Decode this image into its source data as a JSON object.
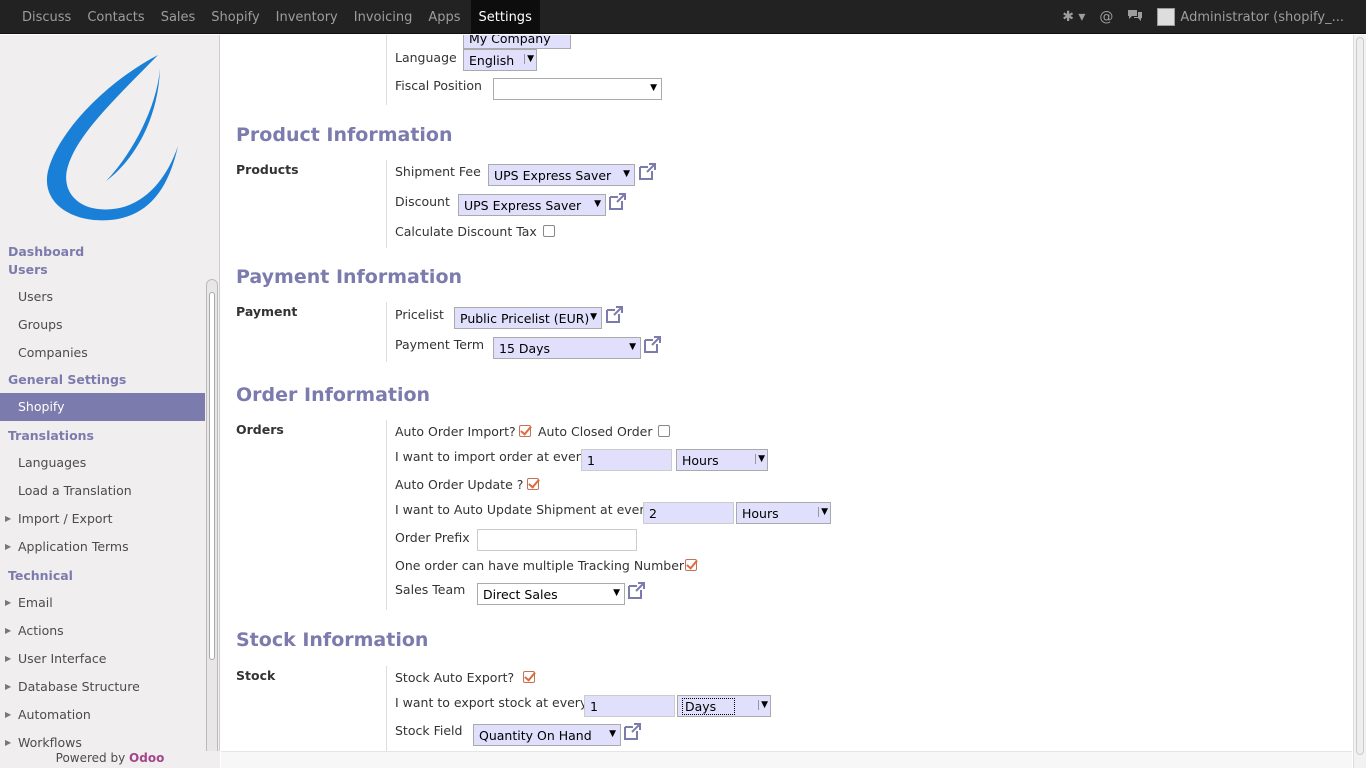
{
  "topbar": {
    "menu": [
      "Discuss",
      "Contacts",
      "Sales",
      "Shopify",
      "Inventory",
      "Invoicing",
      "Apps",
      "Settings"
    ],
    "active": "Settings",
    "user": "Administrator (shopify_..."
  },
  "sidebar": {
    "dashboard": "Dashboard",
    "users_section": "Users",
    "users": "Users",
    "groups": "Groups",
    "companies": "Companies",
    "general_section": "General Settings",
    "shopify": "Shopify",
    "translations_section": "Translations",
    "languages": "Languages",
    "load_translation": "Load a Translation",
    "import_export": "Import / Export",
    "application_terms": "Application Terms",
    "technical_section": "Technical",
    "email": "Email",
    "actions": "Actions",
    "user_interface": "User Interface",
    "database_structure": "Database Structure",
    "automation": "Automation",
    "workflows": "Workflows",
    "powered_prefix": "Powered by",
    "powered_brand": "Odoo"
  },
  "top_partial": {
    "company_value": "My Company",
    "language_label": "Language",
    "language_value": "English",
    "fiscal_label": "Fiscal Position",
    "fiscal_value": ""
  },
  "product": {
    "title": "Product Information",
    "group": "Products",
    "shipment_label": "Shipment Fee",
    "shipment_value": "UPS Express Saver",
    "discount_label": "Discount",
    "discount_value": "UPS Express Saver",
    "calc_label": "Calculate Discount Tax",
    "calc_checked": false
  },
  "payment": {
    "title": "Payment Information",
    "group": "Payment",
    "pricelist_label": "Pricelist",
    "pricelist_value": "Public Pricelist (EUR)",
    "term_label": "Payment Term",
    "term_value": "15 Days"
  },
  "order": {
    "title": "Order Information",
    "group": "Orders",
    "auto_import_label": "Auto Order Import?",
    "auto_import_checked": true,
    "auto_closed_label": "Auto Closed Order",
    "auto_closed_checked": false,
    "import_every_label": "I want to import order at every",
    "import_every_value": "1",
    "import_every_unit": "Hours",
    "auto_update_label": "Auto Order Update ?",
    "auto_update_checked": true,
    "update_every_label": "I want to Auto Update Shipment at every",
    "update_every_value": "2",
    "update_every_unit": "Hours",
    "prefix_label": "Order Prefix",
    "prefix_value": "",
    "multi_tracking_label": "One order can have multiple Tracking Number ?",
    "multi_tracking_checked": true,
    "team_label": "Sales Team",
    "team_value": "Direct Sales"
  },
  "stock": {
    "title": "Stock Information",
    "group": "Stock",
    "auto_export_label": "Stock Auto Export?",
    "auto_export_checked": true,
    "export_every_label": "I want to export stock at every",
    "export_every_value": "1",
    "export_every_unit": "Days",
    "field_label": "Stock Field",
    "field_value": "Quantity On Hand"
  },
  "colors": {
    "accent": "#7c7bad",
    "topbar": "#222222",
    "sidebar": "#f0eeee",
    "input": "#e0e0fc"
  }
}
